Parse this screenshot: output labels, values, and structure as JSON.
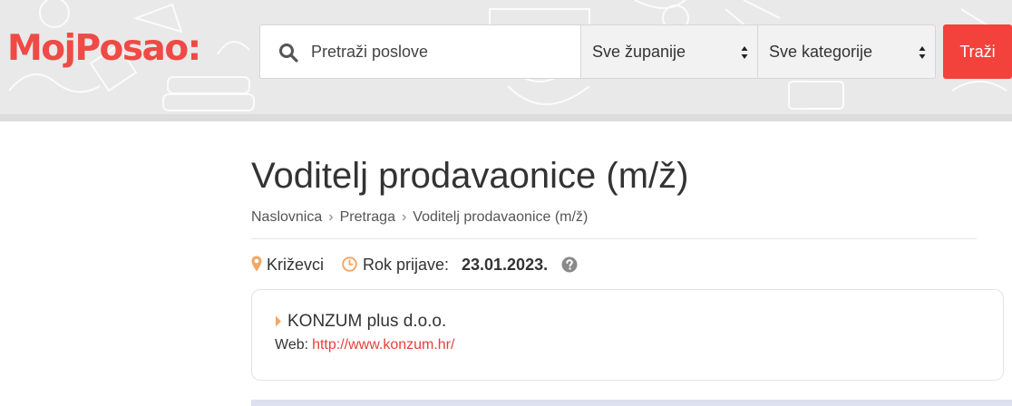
{
  "header": {
    "logo": "MojPosao:",
    "search": {
      "placeholder": "Pretraži poslove",
      "value": ""
    },
    "county_select": {
      "selected": "Sve županije"
    },
    "category_select": {
      "selected": "Sve kategorije"
    },
    "search_button_label": "Traži"
  },
  "job": {
    "title": "Voditelj prodavaonice (m/ž)",
    "breadcrumb": [
      "Naslovnica",
      "Pretraga",
      "Voditelj prodavaonice (m/ž)"
    ],
    "breadcrumb_separator": "›",
    "location": "Križevci",
    "deadline_label": "Rok prijave:",
    "deadline_date": "23.01.2023."
  },
  "company": {
    "name": "KONZUM plus d.o.o.",
    "web_label": "Web:",
    "web_url": "http://www.konzum.hr/"
  },
  "colors": {
    "brand": "#ef4a45",
    "button": "#f2423b",
    "accent_icon": "#f0a868",
    "link": "#e8403a"
  },
  "icons": {
    "search": "search-icon",
    "location": "map-pin-icon",
    "deadline": "clock-icon",
    "help": "question-circle-icon",
    "company": "caret-right-icon",
    "select": "select-arrows-icon"
  }
}
